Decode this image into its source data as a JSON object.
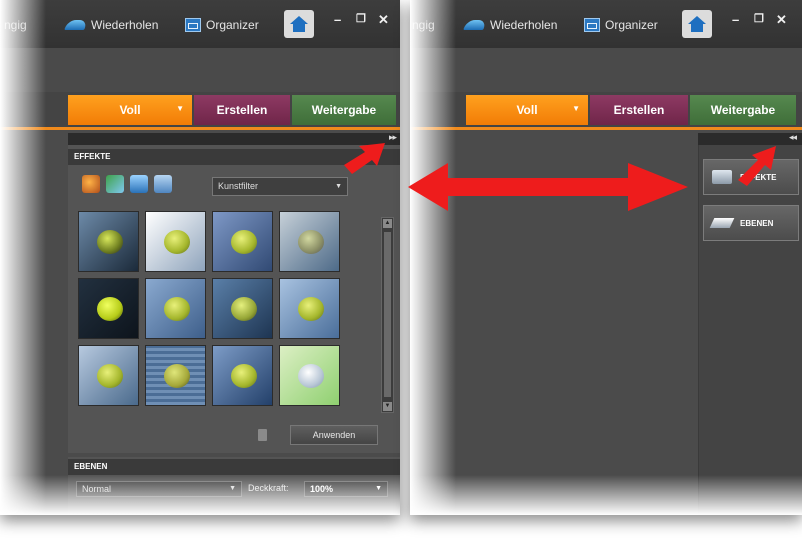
{
  "left_panel": {
    "toolbar": {
      "undo_partial": "ngig",
      "redo_label": "Wiederholen",
      "organizer_label": "Organizer",
      "home_icon": "home-icon",
      "minimize": "–",
      "restore": "❐",
      "close": "✕"
    },
    "tabs": [
      {
        "label": "Voll",
        "color": "#f5890e"
      },
      {
        "label": "Erstellen",
        "color": "#7a2d52"
      },
      {
        "label": "Weitergabe",
        "color": "#4a7c44"
      }
    ],
    "collapse_glyph": "▸▸",
    "effects_panel": {
      "header": "EFFEKTE",
      "filter_select": "Kunstfilter",
      "thumbnail_count": 12,
      "apply_label": "Anwenden"
    },
    "layers_panel": {
      "header": "EBENEN",
      "blend_mode": "Normal",
      "opacity_label": "Deckkraft:",
      "opacity_value": "100%"
    }
  },
  "right_panel": {
    "toolbar": {
      "undo_partial": "ngig",
      "redo_label": "Wiederholen",
      "organizer_label": "Organizer",
      "minimize": "–",
      "restore": "❐",
      "close": "✕"
    },
    "tabs": [
      {
        "label": "Voll"
      },
      {
        "label": "Erstellen"
      },
      {
        "label": "Weitergabe"
      }
    ],
    "expand_glyph": "◂◂",
    "dock_buttons": [
      {
        "label": "EFFEKTE",
        "icon": "effects-icon"
      },
      {
        "label": "EBENEN",
        "icon": "layers-icon"
      }
    ]
  },
  "annotation_color": "#ee1c1c"
}
